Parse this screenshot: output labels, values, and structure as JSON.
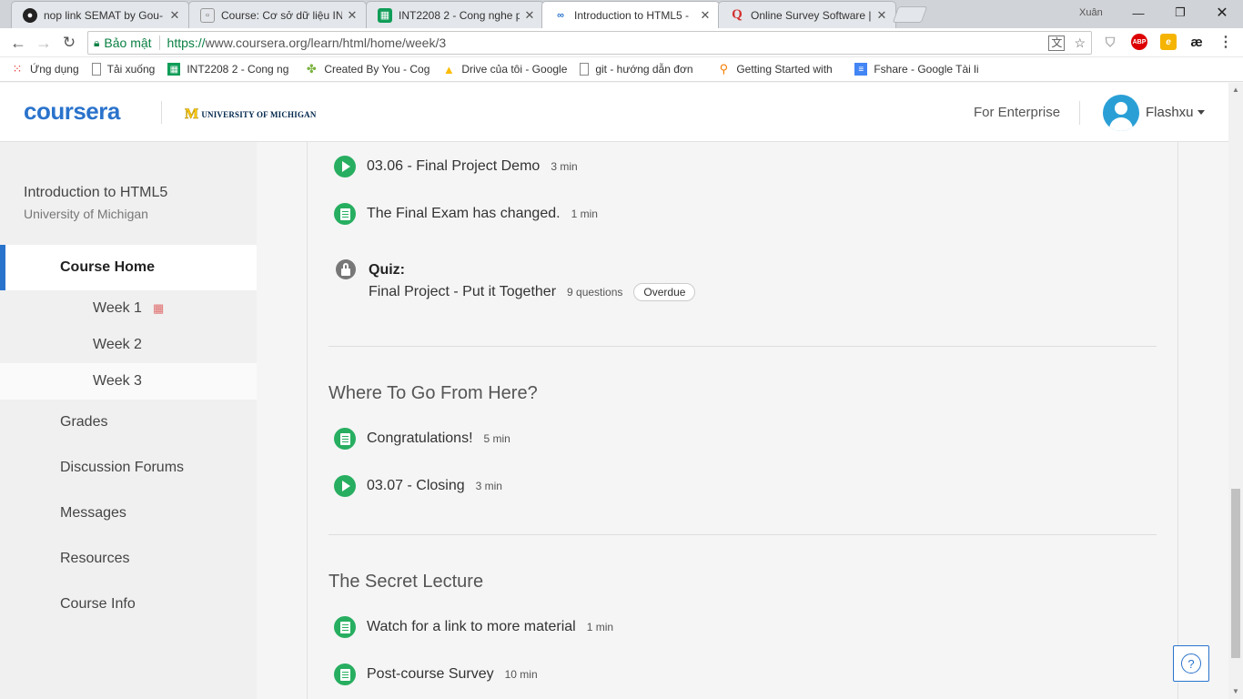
{
  "browser": {
    "tabs": [
      {
        "title": "nop link SEMAT by Gou-",
        "favicon": "github-icon"
      },
      {
        "title": "Course: Cơ sở dữ liệu INT",
        "favicon": "page-icon"
      },
      {
        "title": "INT2208 2 - Cong nghe p",
        "favicon": "sheets-icon"
      },
      {
        "title": "Introduction to HTML5 -",
        "favicon": "coursera-icon"
      },
      {
        "title": "Online Survey Software |",
        "favicon": "qualtrics-icon"
      }
    ],
    "window_user": "Xuân",
    "secure_label": "Bảo mật",
    "url_protocol": "https://",
    "url_rest": "www.coursera.org/learn/html/home/week/3",
    "bookmarks": [
      {
        "label": "Ứng dụng",
        "icon": "apps-grid-icon"
      },
      {
        "label": "Tải xuống",
        "icon": "page-icon"
      },
      {
        "label": "INT2208 2 - Cong ng",
        "icon": "sheets-icon"
      },
      {
        "label": "Created By You - Cog",
        "icon": "puzzle-icon"
      },
      {
        "label": "Drive của tôi - Google",
        "icon": "drive-icon"
      },
      {
        "label": "git - hướng dẫn đơn",
        "icon": "page-icon"
      },
      {
        "label": "Getting Started with",
        "icon": "search-icon"
      },
      {
        "label": "Fshare - Google Tài li",
        "icon": "docs-icon"
      }
    ],
    "extensions": [
      "shield-icon",
      "adblock-icon",
      "extension-e-icon",
      "ae-icon"
    ]
  },
  "header": {
    "logo": "coursera",
    "partner": "UNIVERSITY OF MICHIGAN",
    "enterprise": "For Enterprise",
    "username": "Flashxu"
  },
  "sidebar": {
    "course_title": "Introduction to HTML5",
    "course_sub": "University of Michigan",
    "home": "Course Home",
    "weeks": [
      "Week 1",
      "Week 2",
      "Week 3"
    ],
    "items": [
      "Grades",
      "Discussion Forums",
      "Messages",
      "Resources",
      "Course Info"
    ]
  },
  "main": {
    "items_top": [
      {
        "type": "video",
        "title": "03.06 - Final Project Demo",
        "duration": "3 min"
      },
      {
        "type": "reading",
        "title": "The Final Exam has changed.",
        "duration": "1 min"
      }
    ],
    "quiz": {
      "label": "Quiz:",
      "title": "Final Project - Put it Together",
      "questions": "9 questions",
      "badge": "Overdue"
    },
    "sections": [
      {
        "title": "Where To Go From Here?",
        "items": [
          {
            "type": "reading",
            "title": "Congratulations!",
            "duration": "5 min"
          },
          {
            "type": "video",
            "title": "03.07 - Closing",
            "duration": "3 min"
          }
        ]
      },
      {
        "title": "The Secret Lecture",
        "items": [
          {
            "type": "reading",
            "title": "Watch for a link to more material",
            "duration": "1 min"
          },
          {
            "type": "reading",
            "title": "Post-course Survey",
            "duration": "10 min"
          }
        ]
      }
    ],
    "help_label": "?"
  },
  "colors": {
    "brand": "#2a73cc",
    "item_icon": "#27ae60",
    "sidebar_bg": "#f0f0f0"
  }
}
